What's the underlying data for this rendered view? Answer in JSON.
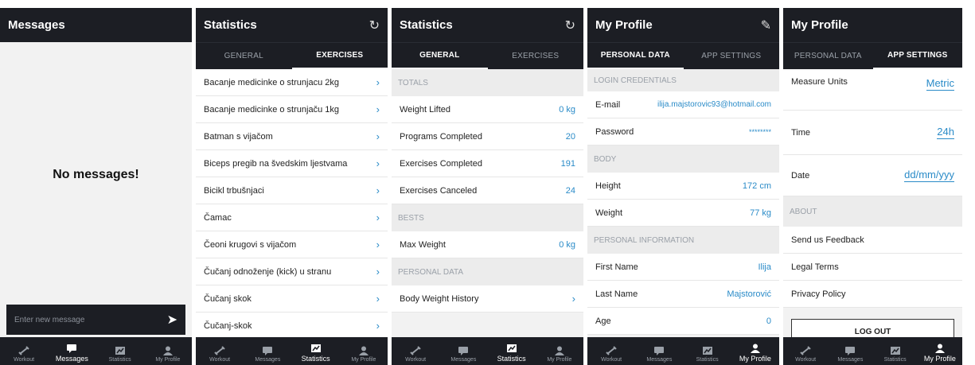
{
  "nav": {
    "workout": "Workout",
    "messages": "Messages",
    "statistics": "Statistics",
    "profile": "My Profile"
  },
  "messages": {
    "title": "Messages",
    "empty": "No messages!",
    "placeholder": "Enter new message"
  },
  "stats_ex": {
    "title": "Statistics",
    "tabs": [
      "GENERAL",
      "EXERCISES"
    ],
    "items": [
      "Bacanje medicinke o strunjacu 2kg",
      "Bacanje medicinke o strunjaču 1kg",
      "Batman s vijačom",
      "Biceps pregib na švedskim ljestvama",
      "Bicikl trbušnjaci",
      "Čamac",
      "Čeoni krugovi s vijačom",
      "Čučanj odnoženje (kick) u stranu",
      "Čučanj skok",
      "Čučanj-skok"
    ]
  },
  "stats_gen": {
    "title": "Statistics",
    "tabs": [
      "GENERAL",
      "EXERCISES"
    ],
    "totals": "TOTALS",
    "weight_lifted": "Weight Lifted",
    "weight_lifted_v": "0 kg",
    "programs": "Programs Completed",
    "programs_v": "20",
    "exercises": "Exercises Completed",
    "exercises_v": "191",
    "canceled": "Exercises Canceled",
    "canceled_v": "24",
    "bests": "BESTS",
    "max_weight": "Max Weight",
    "max_weight_v": "0 kg",
    "personal": "PERSONAL DATA",
    "bw_history": "Body Weight History"
  },
  "profile": {
    "title": "My Profile",
    "tabs": [
      "PERSONAL DATA",
      "APP SETTINGS"
    ],
    "login": "LOGIN CREDENTIALS",
    "email": "E-mail",
    "email_v": "ilija.majstorovic93@hotmail.com",
    "password": "Password",
    "password_v": "********",
    "body": "BODY",
    "height": "Height",
    "height_v": "172 cm",
    "weight": "Weight",
    "weight_v": "77 kg",
    "pinfo": "PERSONAL INFORMATION",
    "first": "First Name",
    "first_v": "Ilija",
    "last": "Last Name",
    "last_v": "Majstorović",
    "age": "Age",
    "age_v": "0"
  },
  "settings": {
    "title": "My Profile",
    "tabs": [
      "PERSONAL DATA",
      "APP SETTINGS"
    ],
    "units": "Measure Units",
    "units_v": "Metric",
    "time": "Time",
    "time_v": "24h",
    "date": "Date",
    "date_v": "dd/mm/yyy",
    "about": "ABOUT",
    "feedback": "Send us Feedback",
    "legal": "Legal Terms",
    "privacy": "Privacy Policy",
    "logout": "LOG OUT"
  }
}
